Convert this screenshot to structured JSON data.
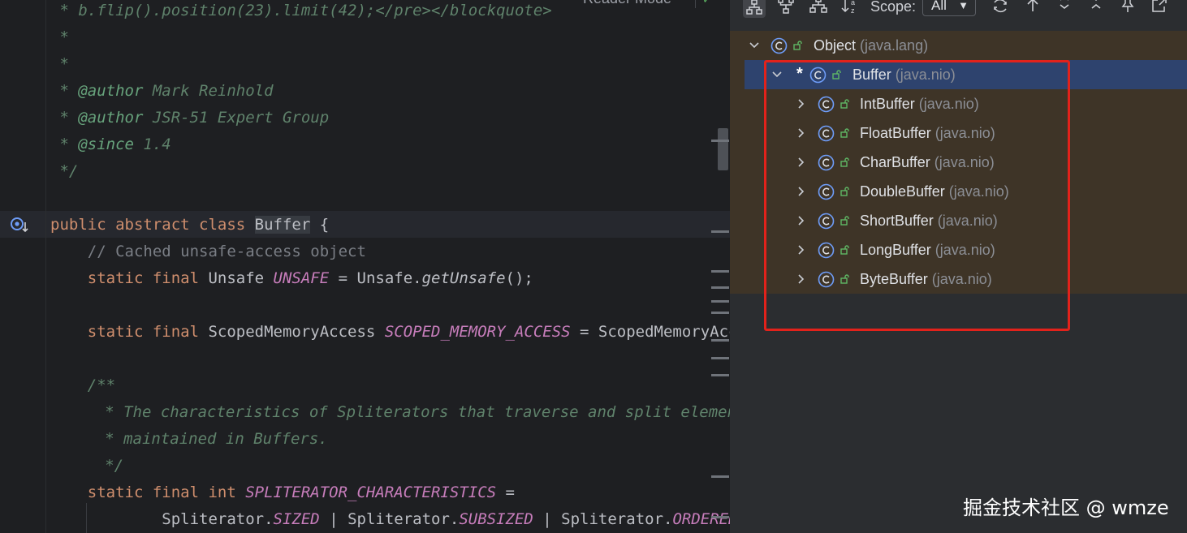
{
  "editor": {
    "reader_mode_label": "Reader Mode",
    "lines": [
      [
        {
          "t": " * b.flip().position(23).limit(42);</pre></blockquote>",
          "c": "c-doc"
        }
      ],
      [
        {
          "t": " *",
          "c": "c-doc"
        }
      ],
      [
        {
          "t": " *",
          "c": "c-doc"
        }
      ],
      [
        {
          "t": " * ",
          "c": "c-doc"
        },
        {
          "t": "@author",
          "c": "c-tag"
        },
        {
          "t": " Mark Reinhold",
          "c": "c-doc"
        }
      ],
      [
        {
          "t": " * ",
          "c": "c-doc"
        },
        {
          "t": "@author",
          "c": "c-tag"
        },
        {
          "t": " JSR-51 Expert Group",
          "c": "c-doc"
        }
      ],
      [
        {
          "t": " * ",
          "c": "c-doc"
        },
        {
          "t": "@since",
          "c": "c-tag"
        },
        {
          "t": " 1.4",
          "c": "c-doc"
        }
      ],
      [
        {
          "t": " */",
          "c": "c-doc"
        }
      ],
      [
        {
          "t": "",
          "c": ""
        }
      ],
      [
        {
          "t": "public abstract class ",
          "c": "c-kw"
        },
        {
          "t": "Buffer",
          "c": "c-cls-hl"
        },
        {
          "t": " {",
          "c": ""
        }
      ],
      [
        {
          "t": "    // Cached unsafe-access object",
          "c": "c-cmt"
        }
      ],
      [
        {
          "t": "    static final ",
          "c": "c-kw"
        },
        {
          "t": "Unsafe ",
          "c": ""
        },
        {
          "t": "UNSAFE",
          "c": "c-fld"
        },
        {
          "t": " = Unsafe.",
          "c": ""
        },
        {
          "t": "getUnsafe",
          "c": "c-mth"
        },
        {
          "t": "();",
          "c": ""
        }
      ],
      [
        {
          "t": "",
          "c": ""
        }
      ],
      [
        {
          "t": "    static final ",
          "c": "c-kw"
        },
        {
          "t": "ScopedMemoryAccess ",
          "c": ""
        },
        {
          "t": "SCOPED_MEMORY_ACCESS",
          "c": "c-fld"
        },
        {
          "t": " = ScopedMemoryAccess",
          "c": ""
        }
      ],
      [
        {
          "t": "",
          "c": ""
        }
      ],
      [
        {
          "t": "    /**",
          "c": "c-doc"
        }
      ],
      [
        {
          "t": "     * The characteristics of Spliterators that traverse and split elements",
          "c": "c-doc"
        }
      ],
      [
        {
          "t": "     * maintained in Buffers.",
          "c": "c-doc"
        }
      ],
      [
        {
          "t": "     */",
          "c": "c-doc"
        }
      ],
      [
        {
          "t": "    static final int ",
          "c": "c-kw"
        },
        {
          "t": "SPLITERATOR_CHARACTERISTICS",
          "c": "c-fld"
        },
        {
          "t": " =",
          "c": ""
        }
      ],
      [
        {
          "t": "            Spliterator.",
          "c": ""
        },
        {
          "t": "SIZED",
          "c": "c-fld"
        },
        {
          "t": " | Spliterator.",
          "c": ""
        },
        {
          "t": "SUBSIZED",
          "c": "c-fld"
        },
        {
          "t": " | Spliterator.",
          "c": ""
        },
        {
          "t": "ORDERED",
          "c": "c-fld"
        }
      ]
    ]
  },
  "toolbar": {
    "scope_label": "Scope:",
    "scope_value": "All",
    "buttons": [
      "subtypes-hierarchy-icon",
      "supertypes-hierarchy-icon",
      "class-hierarchy-icon",
      "sort-alphabetically-icon",
      "refresh-icon",
      "scroll-from-source-icon",
      "expand-all-icon",
      "collapse-all-icon",
      "pin-icon",
      "open-in-new-window-icon"
    ]
  },
  "tree": [
    {
      "name": "Object",
      "pkg": " (java.lang)",
      "level": 0,
      "expanded": true,
      "star": false,
      "selected": false
    },
    {
      "name": "Buffer",
      "pkg": " (java.nio)",
      "level": 1,
      "expanded": true,
      "star": true,
      "selected": true
    },
    {
      "name": "IntBuffer",
      "pkg": " (java.nio)",
      "level": 2,
      "expanded": false,
      "star": false,
      "selected": false
    },
    {
      "name": "FloatBuffer",
      "pkg": " (java.nio)",
      "level": 2,
      "expanded": false,
      "star": false,
      "selected": false
    },
    {
      "name": "CharBuffer",
      "pkg": " (java.nio)",
      "level": 2,
      "expanded": false,
      "star": false,
      "selected": false
    },
    {
      "name": "DoubleBuffer",
      "pkg": " (java.nio)",
      "level": 2,
      "expanded": false,
      "star": false,
      "selected": false
    },
    {
      "name": "ShortBuffer",
      "pkg": " (java.nio)",
      "level": 2,
      "expanded": false,
      "star": false,
      "selected": false
    },
    {
      "name": "LongBuffer",
      "pkg": " (java.nio)",
      "level": 2,
      "expanded": false,
      "star": false,
      "selected": false
    },
    {
      "name": "ByteBuffer",
      "pkg": " (java.nio)",
      "level": 2,
      "expanded": false,
      "star": false,
      "selected": false
    }
  ],
  "watermark": "掘金技术社区 @ wmze",
  "colors": {
    "editor_bg": "#1e1f22",
    "panel_bg": "#2b2d30",
    "tree_highlight_bg": "#3e3427",
    "selection_bg": "#2e436e",
    "annotation_box": "#e2221b",
    "class_icon": "#6e9cf7"
  }
}
